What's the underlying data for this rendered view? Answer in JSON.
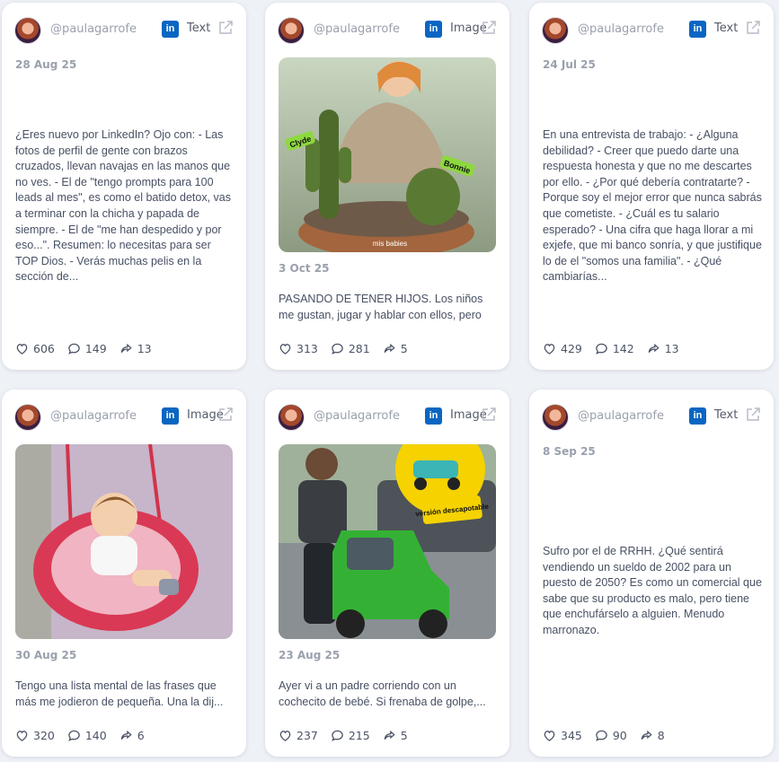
{
  "posts": [
    {
      "username": "@paulagarrofe",
      "type": "Text",
      "date": "28 Aug 25",
      "text": "¿Eres nuevo por LinkedIn? Ojo con: - Las fotos de perfil de gente con brazos cruzados, llevan navajas en las manos que no ves. - El de \"tengo prompts para 100 leads al mes\", es como el batido detox, vas a terminar con la chicha y papada de siempre. - El de \"me han despedido y por eso...\". Resumen: lo necesitas para ser TOP Dios. - Verás muchas pelis en la sección de...",
      "likes": "606",
      "comments": "149",
      "shares": "13"
    },
    {
      "username": "@paulagarrofe",
      "type": "Image",
      "date": "3 Oct 25",
      "text": "PASANDO DE TENER HIJOS. Los niños me gustan, jugar y hablar con ellos, pero sin...",
      "image": {
        "labels": [
          "Clyde",
          "Bonnie",
          "mis babies"
        ]
      },
      "likes": "313",
      "comments": "281",
      "shares": "5"
    },
    {
      "username": "@paulagarrofe",
      "type": "Text",
      "date": "24 Jul 25",
      "text": "En una entrevista de trabajo: - ¿Alguna debilidad? - Creer que puedo darte una respuesta honesta y que no me descartes por ello. - ¿Por qué debería contratarte? - Porque soy el mejor error que nunca sabrás que cometiste. - ¿Cuál es tu salario esperado? - Una cifra que haga llorar a mi exjefe, que mi banco sonría, y que justifique lo de el \"somos una familia\". - ¿Qué cambiarías...",
      "likes": "429",
      "comments": "142",
      "shares": "13"
    },
    {
      "username": "@paulagarrofe",
      "type": "Image",
      "date": "30 Aug 25",
      "text": "Tengo una lista mental de las frases que más me jodieron de pequeña. Una la dij...",
      "likes": "320",
      "comments": "140",
      "shares": "6"
    },
    {
      "username": "@paulagarrofe",
      "type": "Image",
      "date": "23 Aug 25",
      "text": "Ayer vi a un padre corriendo con un cochecito de bebé. Si frenaba de golpe,...",
      "image": {
        "labels": [
          "versión descapotable"
        ]
      },
      "likes": "237",
      "comments": "215",
      "shares": "5"
    },
    {
      "username": "@paulagarrofe",
      "type": "Text",
      "date": "8 Sep 25",
      "text": "Sufro por el de RRHH. ¿Qué sentirá vendiendo un sueldo de 2002 para un puesto de 2050? Es como un comercial que sabe que su producto es malo, pero tiene que enchufárselo a alguien. Menudo marronazo.",
      "likes": "345",
      "comments": "90",
      "shares": "8"
    }
  ],
  "icons": {
    "linkedin": "linkedin-icon",
    "external": "external-link-icon",
    "like": "heart-icon",
    "comment": "comment-icon",
    "share": "share-icon"
  },
  "colors": {
    "linkedin": "#0a66c2",
    "background": "#eef1f6"
  }
}
